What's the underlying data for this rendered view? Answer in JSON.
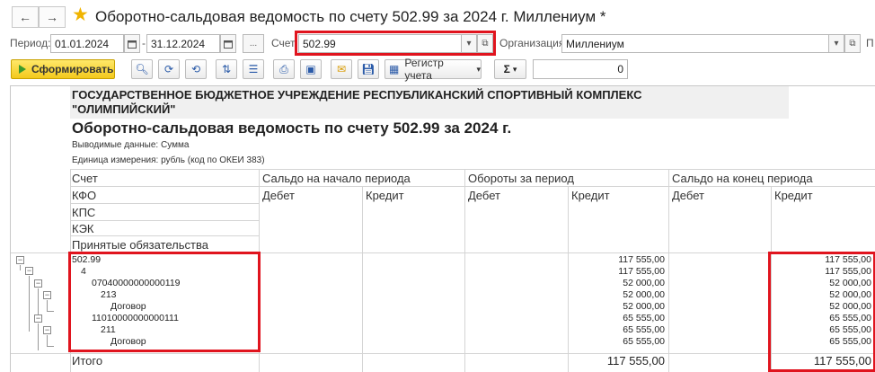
{
  "window": {
    "title": "Оборотно-сальдовая ведомость по счету 502.99 за 2024 г. Миллениум *",
    "back_icon": "←",
    "forward_icon": "→"
  },
  "params": {
    "period_label": "Период:",
    "date_from": "01.01.2024",
    "date_to": "31.12.2024",
    "dots_label": "...",
    "account_label": "Счет:",
    "account_value": "502.99",
    "org_label": "Организация:",
    "org_value": "Миллениум",
    "extra_label": "П"
  },
  "toolbar": {
    "generate_label": "Сформировать",
    "register_label": "Регистр учета",
    "sum_label": "Σ",
    "sum_value": "0"
  },
  "report": {
    "org_name": "ГОСУДАРСТВЕННОЕ БЮДЖЕТНОЕ УЧРЕЖДЕНИЕ РЕСПУБЛИКАНСКИЙ СПОРТИВНЫЙ КОМПЛЕКС \"ОЛИМПИЙСКИЙ\"",
    "title": "Оборотно-сальдовая ведомость по счету 502.99 за 2024 г.",
    "output_data": "Выводимые данные:   Сумма",
    "unit": "Единица измерения: рубль (код по ОКЕИ 383)",
    "headers": {
      "account": "Счет",
      "kfo": "КФО",
      "kps": "КПС",
      "kek": "КЭК",
      "obligations": "Принятые обязательства",
      "opening": "Сальдо на начало периода",
      "turnover": "Обороты за период",
      "closing": "Сальдо на конец периода",
      "debit": "Дебет",
      "credit": "Кредит"
    },
    "rows": [
      {
        "account": "502.99",
        "turnover_credit": "117 555,00",
        "closing_credit": "117 555,00"
      },
      {
        "account": "4",
        "turnover_credit": "117 555,00",
        "closing_credit": "117 555,00"
      },
      {
        "account": "07040000000000119",
        "turnover_credit": "52 000,00",
        "closing_credit": "52 000,00"
      },
      {
        "account": "213",
        "turnover_credit": "52 000,00",
        "closing_credit": "52 000,00"
      },
      {
        "account": "Договор",
        "turnover_credit": "52 000,00",
        "closing_credit": "52 000,00"
      },
      {
        "account": "11010000000000111",
        "turnover_credit": "65 555,00",
        "closing_credit": "65 555,00"
      },
      {
        "account": "211",
        "turnover_credit": "65 555,00",
        "closing_credit": "65 555,00"
      },
      {
        "account": "Договор",
        "turnover_credit": "65 555,00",
        "closing_credit": "65 555,00"
      }
    ],
    "total_label": "Итого",
    "total_turnover_credit": "117 555,00",
    "total_closing_credit": "117 555,00"
  }
}
